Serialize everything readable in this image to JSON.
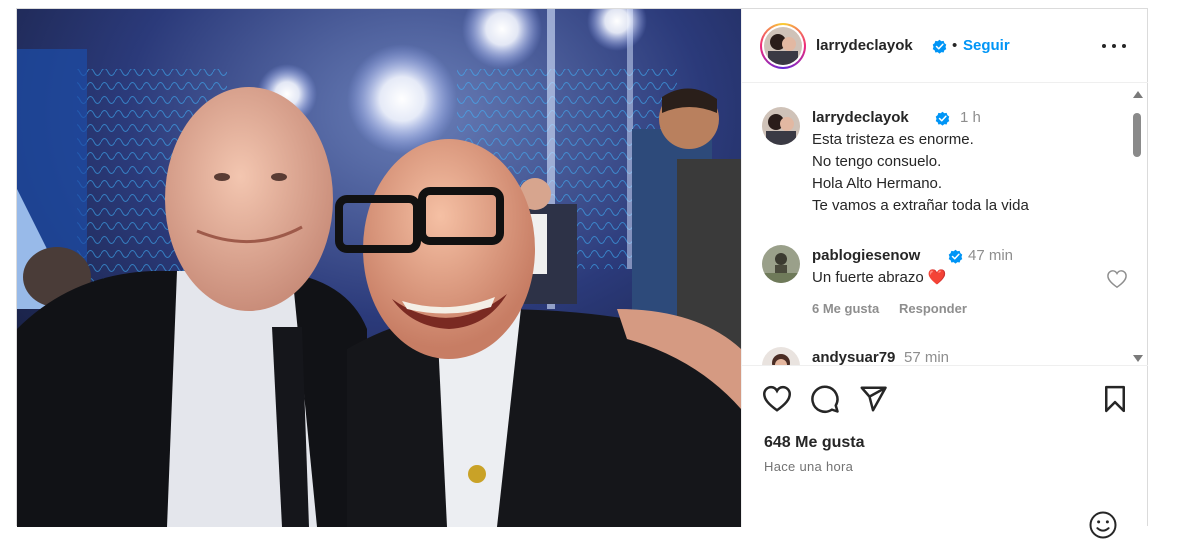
{
  "header": {
    "username": "larrydeclayok",
    "separator": "•",
    "follow_label": "Seguir",
    "more_icon": "more-horizontal-icon"
  },
  "caption": {
    "username": "larrydeclayok",
    "time": "1 h",
    "lines": [
      "Esta tristeza es enorme.",
      "No tengo consuelo.",
      "Hola Alto Hermano.",
      "Te vamos a extrañar toda la vida"
    ]
  },
  "comments": [
    {
      "username": "pablogiesenow",
      "time": "47 min",
      "text": "Un fuerte abrazo",
      "emoji": "❤️",
      "likes": "6 Me gusta",
      "reply": "Responder"
    },
    {
      "username": "andysuar79",
      "time": "57 min"
    }
  ],
  "actions": {
    "likes": "648 Me gusta",
    "when": "Hace una hora"
  },
  "colors": {
    "accent": "#0095f6",
    "verified": "#0095f6",
    "heart": "#ed4956",
    "muted": "#8e8e8e"
  }
}
